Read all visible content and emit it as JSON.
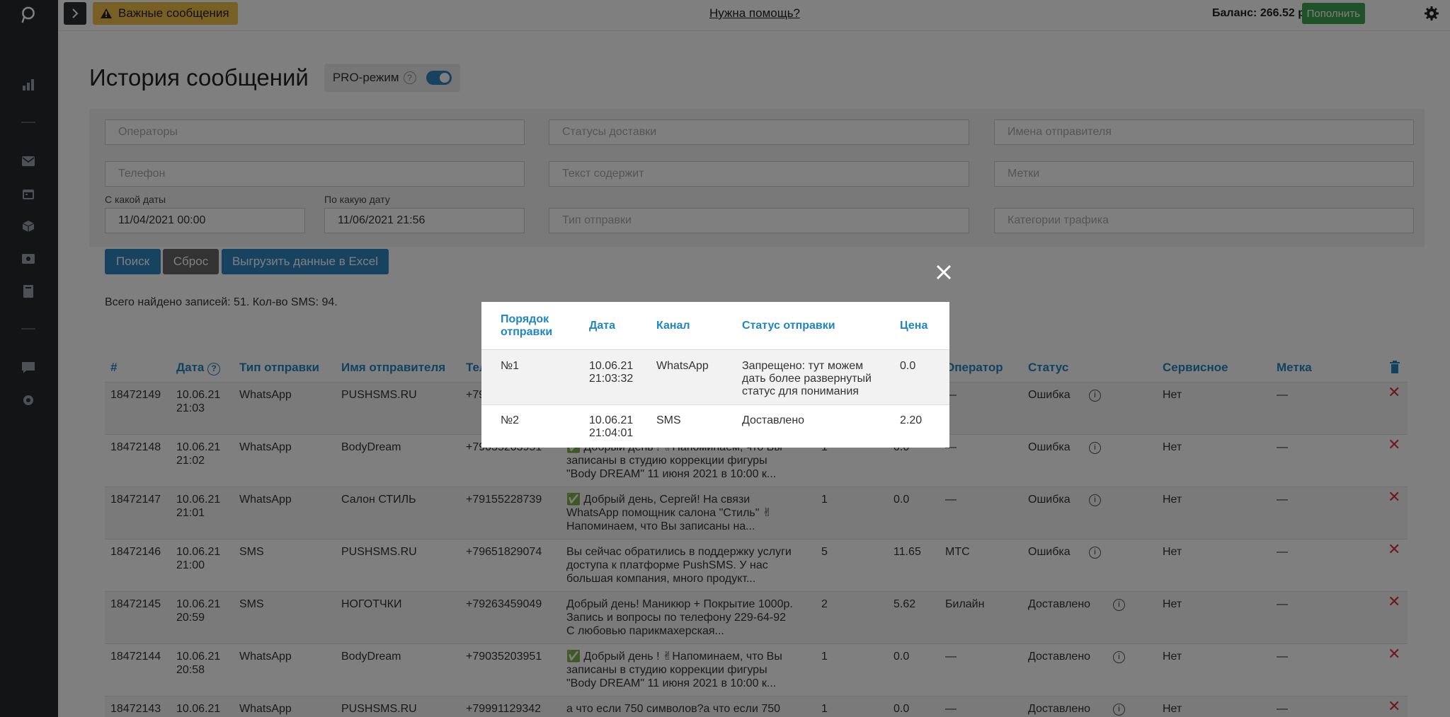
{
  "colors": {
    "accent": "#1f86c3",
    "warn": "#f0c14b",
    "topup": "#3fa552",
    "search_btn": "#2e86c1",
    "reset_btn": "#666666",
    "delete": "#dd3333"
  },
  "topbar": {
    "warning_label": "Важные сообщения",
    "help_link": "Нужна помощь?",
    "balance": "Баланс: 266.52 руб.",
    "topup_button": "Пополнить"
  },
  "sidebar": {
    "icons": [
      "logo-icon",
      "chart-icon",
      "envelope-icon",
      "calendar-icon",
      "box-icon",
      "wallet-icon",
      "book-icon",
      "chat-icon",
      "settings-icon"
    ]
  },
  "page": {
    "title": "История сообщений",
    "pro_label": "PRO-режим",
    "pro_help": "?",
    "pro_enabled": true
  },
  "filters": {
    "operators_placeholder": "Операторы",
    "statuses_placeholder": "Статусы доставки",
    "senders_placeholder": "Имена отправителя",
    "phone_placeholder": "Телефон",
    "text_placeholder": "Текст содержит",
    "tags_placeholder": "Метки",
    "date_from_label": "С какой даты",
    "date_from_value": "11/04/2021 00:00",
    "date_to_label": "По какую дату",
    "date_to_value": "11/06/2021 21:56",
    "send_type_placeholder": "Тип отправки",
    "traffic_placeholder": "Категории трафика"
  },
  "actions": {
    "search": "Поиск",
    "reset": "Сброс",
    "export": "Выгрузить данные в Excel"
  },
  "summary": "Всего найдено записей: 51. Кол-во SMS: 94.",
  "table": {
    "headers": {
      "num": "#",
      "date": "Дата",
      "type": "Тип отправки",
      "sender": "Имя отправителя",
      "phone": "Тел",
      "operator": "Оператор",
      "status": "Статус",
      "service": "Сервисное",
      "tag": "Метка"
    },
    "rows": [
      {
        "id": "18472149",
        "date": "10.06.21",
        "time": "21:03",
        "type": "WhatsApp",
        "sender": "PUSHSMS.RU",
        "phone": "+79",
        "message": "",
        "parts": "",
        "price": "",
        "operator": "—",
        "status": "Ошибка",
        "service": "Нет",
        "tag": "—"
      },
      {
        "id": "18472148",
        "date": "10.06.21",
        "time": "21:02",
        "type": "WhatsApp",
        "sender": "BodyDream",
        "phone": "+79035203951",
        "message": "✅ Добрый день ! ✌Напоминаем, что Вы записаны в студию коррекции фигуры \"Body DREAM\" 11 июня 2021 в 10:00 к...",
        "parts": "1",
        "price": "0.0",
        "operator": "—",
        "status": "Ошибка",
        "service": "Нет",
        "tag": "—"
      },
      {
        "id": "18472147",
        "date": "10.06.21",
        "time": "21:01",
        "type": "WhatsApp",
        "sender": "Салон СТИЛЬ",
        "phone": "+79155228739",
        "message": "✅ Добрый день, Сергей! На связи WhatsApp помощник салона \"Стиль\" ✌Напоминаем, что Вы записаны на...",
        "parts": "1",
        "price": "0.0",
        "operator": "—",
        "status": "Ошибка",
        "service": "Нет",
        "tag": "—"
      },
      {
        "id": "18472146",
        "date": "10.06.21",
        "time": "21:00",
        "type": "SMS",
        "sender": "PUSHSMS.RU",
        "phone": "+79651829074",
        "message": "Вы сейчас обратились в поддержку услуги доступа к платформе PushSMS. У нас большая компания, много продукт...",
        "parts": "5",
        "price": "11.65",
        "operator": "МТС",
        "status": "Ошибка",
        "service": "Нет",
        "tag": "—"
      },
      {
        "id": "18472145",
        "date": "10.06.21",
        "time": "20:59",
        "type": "SMS",
        "sender": "НОГОТЧКИ",
        "phone": "+79263459049",
        "message": "Добрый день! Маникюр + Покрытие 1000р. Запись и вопросы по телефону 229-64-92 С любовью парикмахерская...",
        "parts": "2",
        "price": "5.62",
        "operator": "Билайн",
        "status": "Доставлено",
        "service": "Нет",
        "tag": "—"
      },
      {
        "id": "18472144",
        "date": "10.06.21",
        "time": "20:58",
        "type": "WhatsApp",
        "sender": "BodyDream",
        "phone": "+79035203951",
        "message": "✅ Добрый день ! ✌Напоминаем, что Вы записаны в студию коррекции фигуры \"Body DREAM\" 11 июня 2021 в 10:00 к...",
        "parts": "1",
        "price": "0.0",
        "operator": "—",
        "status": "Доставлено",
        "service": "Нет",
        "tag": "—"
      },
      {
        "id": "18472143",
        "date": "10.06.21",
        "time": "",
        "type": "WhatsApp",
        "sender": "PUSHSMS.RU",
        "phone": "+79991129342",
        "message": "а что если 750 символов?а что если 750",
        "parts": "1",
        "price": "0.0",
        "operator": "—",
        "status": "Доставлено",
        "service": "Нет",
        "tag": "—"
      }
    ]
  },
  "modal": {
    "headers": {
      "order": "Порядок отправки",
      "date": "Дата",
      "channel": "Канал",
      "status": "Статус отправки",
      "price": "Цена"
    },
    "rows": [
      {
        "order": "№1",
        "date": "10.06.21",
        "time": "21:03:32",
        "channel": "WhatsApp",
        "status": "Запрещено: тут можем дать более развернутый статус для понимания",
        "price": "0.0"
      },
      {
        "order": "№2",
        "date": "10.06.21",
        "time": "21:04:01",
        "channel": "SMS",
        "status": "Доставлено",
        "price": "2.20"
      }
    ]
  }
}
